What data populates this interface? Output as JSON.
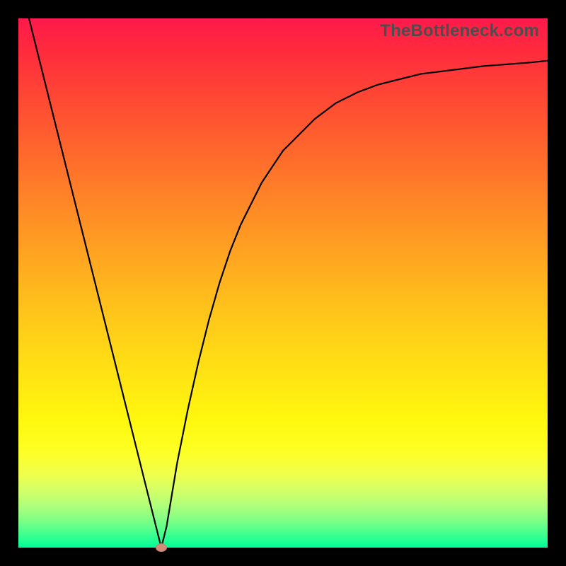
{
  "watermark": "TheBottleneck.com",
  "chart_data": {
    "type": "line",
    "title": "",
    "xlabel": "",
    "ylabel": "",
    "xlim": [
      0,
      100
    ],
    "ylim": [
      0,
      100
    ],
    "grid": false,
    "legend": false,
    "background": "heatmap-gradient-red-to-green",
    "series": [
      {
        "name": "bottleneck-curve",
        "color": "#000000",
        "x": [
          2,
          4,
          6,
          8,
          10,
          12,
          14,
          16,
          18,
          20,
          22,
          24,
          26,
          27,
          28,
          29,
          30,
          32,
          34,
          36,
          38,
          40,
          42,
          44,
          46,
          48,
          50,
          52,
          54,
          56,
          58,
          60,
          64,
          68,
          72,
          76,
          80,
          84,
          88,
          92,
          96,
          100
        ],
        "values": [
          100,
          92,
          84,
          76,
          68,
          60,
          52,
          44,
          36,
          28,
          20,
          12,
          4,
          0,
          4,
          10,
          16,
          26,
          35,
          43,
          50,
          56,
          61,
          65,
          69,
          72,
          75,
          77,
          79,
          81,
          82.5,
          84,
          86,
          87.5,
          88.5,
          89.5,
          90,
          90.5,
          91,
          91.3,
          91.6,
          92
        ]
      }
    ],
    "marker": {
      "x": 27,
      "y": 0,
      "color": "#d38b7a"
    }
  }
}
